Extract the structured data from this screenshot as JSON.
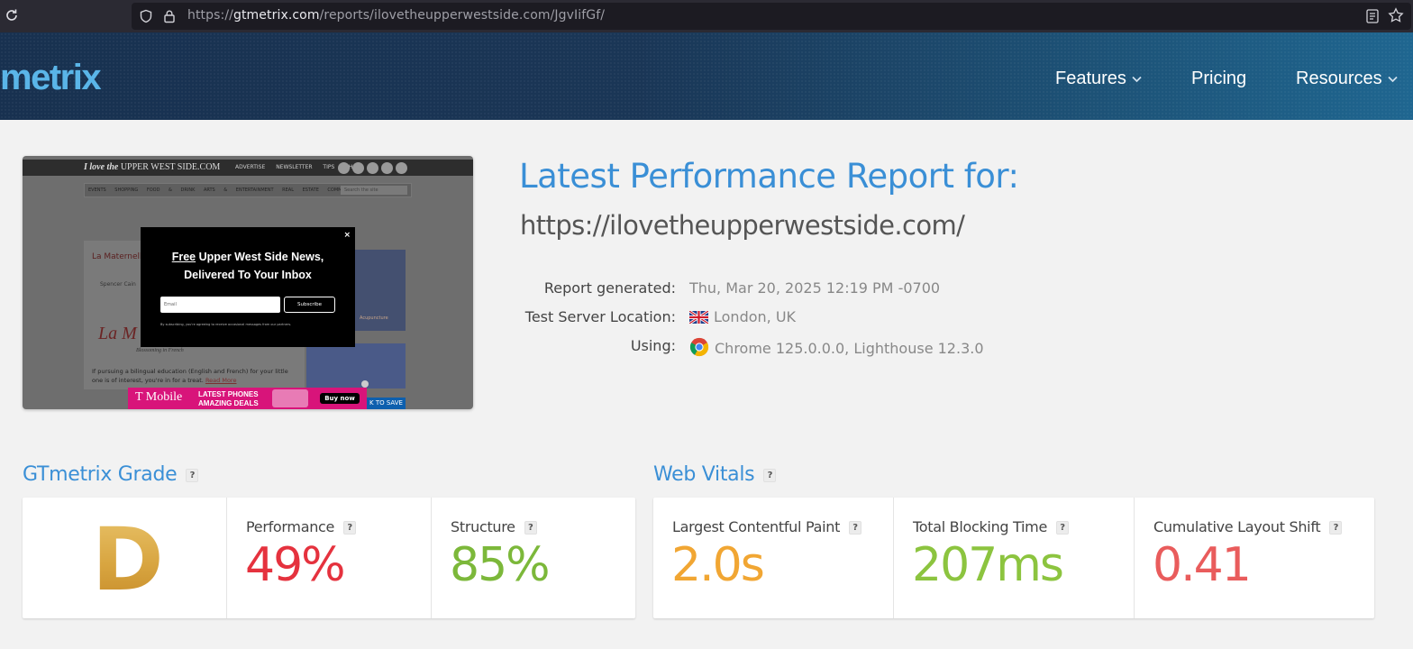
{
  "browser": {
    "url_scheme": "https://",
    "url_host": "gtmetrix.com",
    "url_path": "/reports/ilovetheupperwestside.com/JgvIifGf/"
  },
  "header": {
    "logo": "metrix",
    "nav": [
      {
        "label": "Features",
        "has_dropdown": true
      },
      {
        "label": "Pricing",
        "has_dropdown": false
      },
      {
        "label": "Resources",
        "has_dropdown": true
      }
    ]
  },
  "thumbnail": {
    "brand_prefix": "I love the",
    "brand_suffix": "UPPER WEST SIDE.COM",
    "top_nav": "ADVERTISE NEWSLETTER TIPS SHOP",
    "categories": "EVENTS SHOPPING FOOD & DRINK ARTS & ENTERTAINMENT REAL ESTATE COMMUNITY CELEBRITIES",
    "search_placeholder": "Search the site",
    "card_title": "La Maternelle: Location",
    "card_author": "Spencer Cain",
    "card_script": "La M",
    "card_sub": "Blossoming in French",
    "card_body": "If pursuing a bilingual education (English and French) for your little one is of interest, you're in for a treat.",
    "card_read_more": "Read More",
    "side_label": "Acupuncture",
    "modal_close": "×",
    "modal_free": "Free",
    "modal_title_rest": " Upper West Side News,",
    "modal_title_line2": "Delivered To Your Inbox",
    "modal_email_placeholder": "Email",
    "modal_subscribe": "Subscribe",
    "modal_small": "By subscribing, you're agreeing to receive occasional messages from our partners.",
    "ad_brand": "T Mobile",
    "ad_line1": "LATEST PHONES",
    "ad_line2": "AMAZING DEALS",
    "ad_button": "Buy now",
    "save_badge": "K TO SAVE"
  },
  "report": {
    "title": "Latest Performance Report for:",
    "url": "https://ilovetheupperwestside.com/",
    "meta": [
      {
        "label": "Report generated:",
        "value": "Thu, Mar 20, 2025 12:19 PM -0700",
        "icon": ""
      },
      {
        "label": "Test Server Location:",
        "value": "London, UK",
        "icon": "uk-flag-icon"
      },
      {
        "label": "Using:",
        "value": "Chrome 125.0.0.0, Lighthouse 12.3.0",
        "icon": "chrome-icon"
      }
    ]
  },
  "grade": {
    "section_title": "GTmetrix Grade",
    "help": "?",
    "letter": "D",
    "metrics": [
      {
        "label": "Performance",
        "value": "49%",
        "color": "#e5323e"
      },
      {
        "label": "Structure",
        "value": "85%",
        "color": "#7cb83a"
      }
    ]
  },
  "vitals": {
    "section_title": "Web Vitals",
    "help": "?",
    "metrics": [
      {
        "label": "Largest Contentful Paint",
        "value": "2.0s",
        "color": "#f1a633"
      },
      {
        "label": "Total Blocking Time",
        "value": "207ms",
        "color": "#8cc43f"
      },
      {
        "label": "Cumulative Layout Shift",
        "value": "0.41",
        "color": "#e95c5c"
      }
    ]
  },
  "colors": {
    "accent": "#3a8fd6",
    "grade_gold": "#d8a540"
  }
}
